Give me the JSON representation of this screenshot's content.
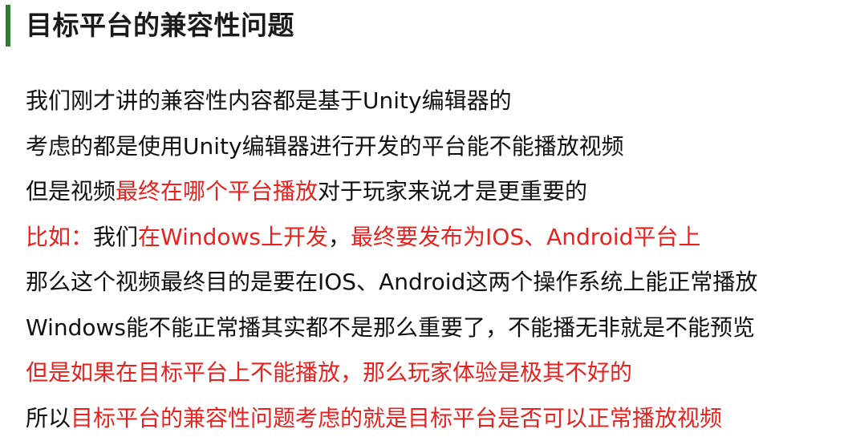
{
  "title": "目标平台的兼容性问题",
  "lines": [
    {
      "segments": [
        {
          "text": "我们刚才讲的兼容性内容都是基于Unity编辑器的",
          "color": "#111111"
        }
      ]
    },
    {
      "segments": [
        {
          "text": "考虑的都是使用Unity编辑器进行开发的平台能不能播放视频",
          "color": "#111111"
        }
      ]
    },
    {
      "segments": [
        {
          "text": "但是视频",
          "color": "#111111"
        },
        {
          "text": "最终在哪个平台播放",
          "color": "#e8231f"
        },
        {
          "text": "对于玩家来说才是更重要的",
          "color": "#111111"
        }
      ]
    },
    {
      "segments": [
        {
          "text": "比如：",
          "color": "#e8231f"
        },
        {
          "text": "我们",
          "color": "#111111"
        },
        {
          "text": "在Windows上开发",
          "color": "#e8231f"
        },
        {
          "text": "，",
          "color": "#111111"
        },
        {
          "text": "最终要发布为IOS、Android平台上",
          "color": "#e8231f"
        }
      ]
    },
    {
      "segments": [
        {
          "text": "那么这个视频最终目的是要在IOS、Android这两个操作系统上能正常播放",
          "color": "#111111"
        }
      ]
    },
    {
      "segments": [
        {
          "text": "Windows能不能正常播其实都不是那么重要了，不能播无非就是不能预览",
          "color": "#111111"
        }
      ]
    },
    {
      "segments": [
        {
          "text": "但是如果在目标平台上不能播放，那么玩家体验是极其不好的",
          "color": "#e8231f"
        }
      ]
    },
    {
      "segments": [
        {
          "text": "所以",
          "color": "#111111"
        },
        {
          "text": "目标平台的兼容性问题考虑的就是目标平台是否可以正常播放视频",
          "color": "#e8231f"
        }
      ]
    }
  ]
}
